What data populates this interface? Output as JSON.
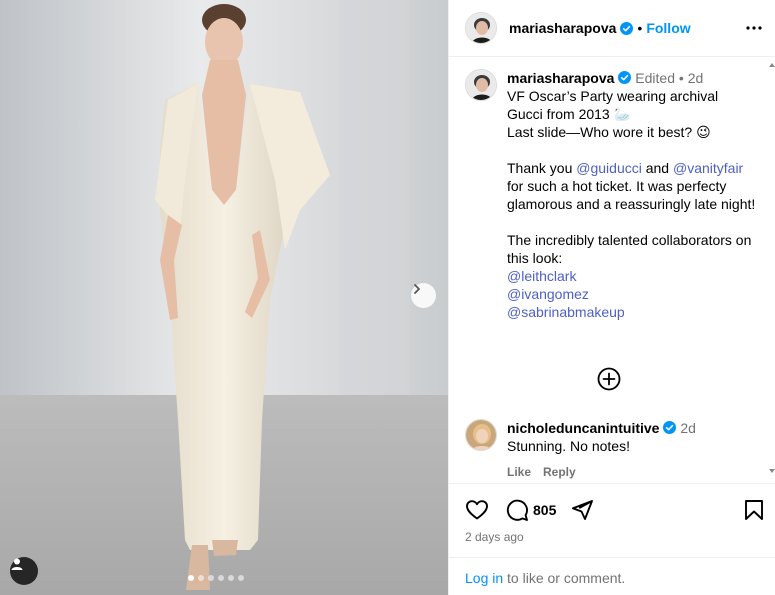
{
  "post": {
    "author": "mariasharapova",
    "follow_label": "Follow",
    "separator": "•",
    "caption": {
      "author": "mariasharapova",
      "edited": "Edited",
      "dot": "•",
      "time": "2d",
      "line1": "VF Oscar’s Party wearing archival Gucci from 2013 🦢",
      "line2": "Last slide—Who wore it best? 😉",
      "thanks_pre": "Thank you ",
      "mention1": "@guiducci",
      "thanks_and": " and ",
      "mention2": "@vanityfair",
      "thanks_post": " for such a hot ticket. It was perfecty glamorous and a reassuringly late night!",
      "collab_text": "The incredibly talented collaborators on this look:",
      "collab1": "@leithclark",
      "collab2": "@ivangomez",
      "collab3": "@sabrinabmakeup"
    },
    "comment": {
      "author": "nicholeduncanintuitive",
      "time": "2d",
      "text": "Stunning. No notes!",
      "like_label": "Like",
      "reply_label": "Reply"
    },
    "comment_count": "805",
    "posted_ago": "2 days ago",
    "login_label": "Log in",
    "login_suffix": " to like or comment."
  },
  "carousel": {
    "total": 6,
    "active_index": 0
  },
  "colors": {
    "accent": "#0095f6",
    "mention": "#4e5fc6",
    "muted": "#737373",
    "verified": "#0095f6"
  },
  "icons": [
    "verified-badge-icon",
    "more-options-icon",
    "chevron-right-icon",
    "user-tag-icon",
    "plus-circle-icon",
    "heart-icon",
    "comment-icon",
    "share-icon",
    "bookmark-icon"
  ]
}
